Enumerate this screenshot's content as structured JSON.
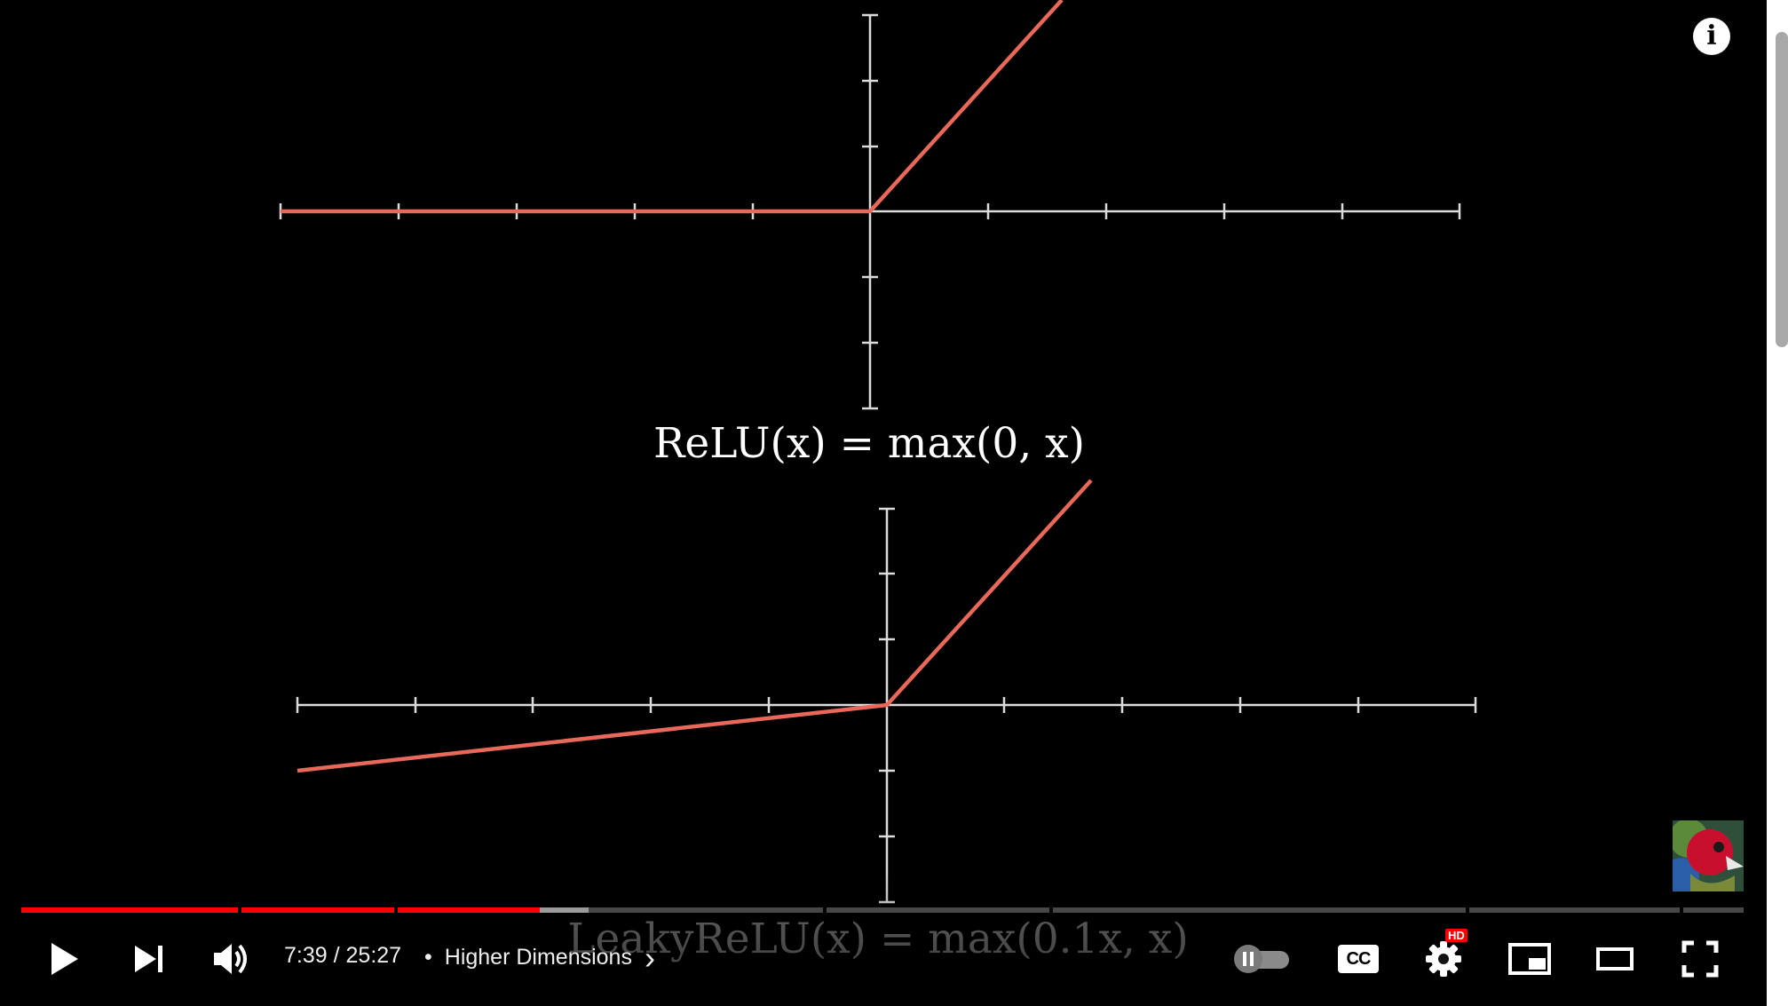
{
  "video": {
    "formula_relu": "ReLU(x) = max(0, x)",
    "formula_leaky": "LeakyReLU(x) = max(0.1x, x)"
  },
  "info_icon_glyph": "i",
  "player": {
    "current_time": "7:39",
    "separator": " / ",
    "duration": "25:27",
    "chapter_dot": "•",
    "chapter_title": "Higher Dimensions",
    "chapter_chevron": "›",
    "progress_fraction": 0.3008,
    "buffered_fraction": 0.3296
  },
  "controls": {
    "cc_label": "CC",
    "hd_badge": "HD"
  },
  "icons": {
    "play": "play-icon",
    "next": "next-icon",
    "volume": "volume-icon",
    "autoplay": "autoplay-toggle-icon",
    "captions": "captions-icon",
    "settings": "settings-gear-icon",
    "miniplayer": "miniplayer-icon",
    "theater": "theater-mode-icon",
    "fullscreen": "fullscreen-icon",
    "info": "info-icon"
  },
  "colors": {
    "curve": "#e8685a",
    "axis": "#e0e0e0",
    "played": "#ff0000",
    "background": "#000000"
  }
}
